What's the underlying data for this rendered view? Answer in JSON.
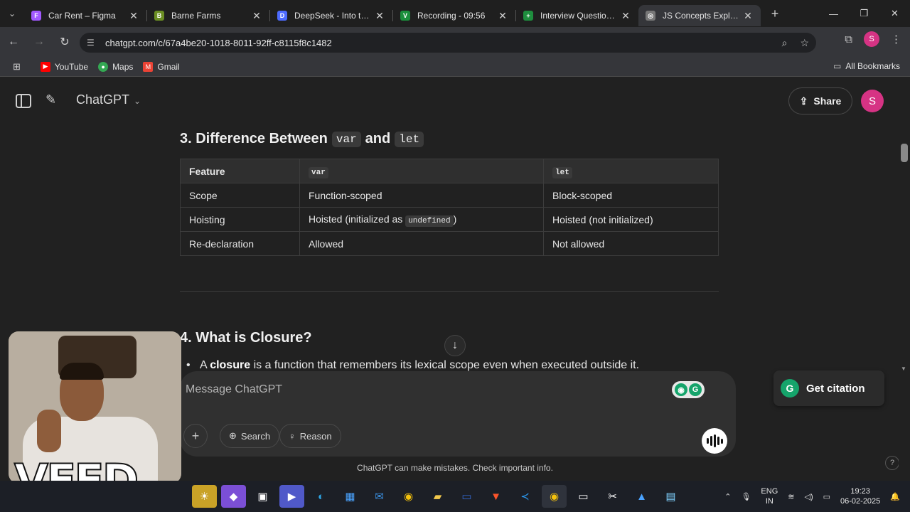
{
  "browser": {
    "tabs": [
      {
        "title": "Car Rent – Figma",
        "fav_color": "#a259ff",
        "fav": "F"
      },
      {
        "title": "Barne Farms",
        "fav_color": "#6b8e23",
        "fav": "B"
      },
      {
        "title": "DeepSeek - Into the Unknown",
        "fav_color": "#4d6bfe",
        "fav": "D"
      },
      {
        "title": "Recording - 09:56",
        "fav_color": "#1a8f3c",
        "fav": "V"
      },
      {
        "title": "Interview Question.xlsx",
        "fav_color": "#1e8e3e",
        "fav": "+"
      },
      {
        "title": "JS Concepts Explained",
        "fav_color": "#777777",
        "fav": "◎"
      }
    ],
    "url": "chatgpt.com/c/67a4be20-1018-8011-92ff-c8115f8c1482",
    "profile_initial": "S",
    "bookmarks": [
      {
        "label": "YouTube",
        "color": "#ff0000",
        "icon": "▶"
      },
      {
        "label": "Maps",
        "color": "#34a853",
        "icon": "●"
      },
      {
        "label": "Gmail",
        "color": "#ea4335",
        "icon": "M"
      }
    ],
    "all_bookmarks": "All Bookmarks"
  },
  "chatgpt": {
    "model": "ChatGPT",
    "share": "Share",
    "avatar_initial": "S",
    "section3": {
      "prefix": "3. Difference Between",
      "code1": "var",
      "mid": "and",
      "code2": "let"
    },
    "table": {
      "headers": [
        "Feature",
        "var",
        "let"
      ],
      "rows": [
        {
          "feature": "Scope",
          "var": "Function-scoped",
          "let": "Block-scoped"
        },
        {
          "feature": "Hoisting",
          "var_pre": "Hoisted (initialized as",
          "var_code": "undefined",
          "var_post": ")",
          "let": "Hoisted (not initialized)"
        },
        {
          "feature": "Re-declaration",
          "var": "Allowed",
          "let": "Not allowed"
        }
      ]
    },
    "section4": "4. What is Closure?",
    "bullet_a": "A",
    "bullet_bold": "closure",
    "bullet_rest": "is a function that remembers its lexical scope even when executed outside it.",
    "composer": {
      "placeholder": "Message ChatGPT",
      "search": "Search",
      "reason": "Reason"
    },
    "disclaimer": "ChatGPT can make mistakes. Check important info.",
    "citation": "Get citation",
    "help": "?"
  },
  "overlay": {
    "watermark": "VEED"
  },
  "taskbar": {
    "lang_line1": "ENG",
    "lang_line2": "IN",
    "time": "19:23",
    "date": "06-02-2025"
  }
}
